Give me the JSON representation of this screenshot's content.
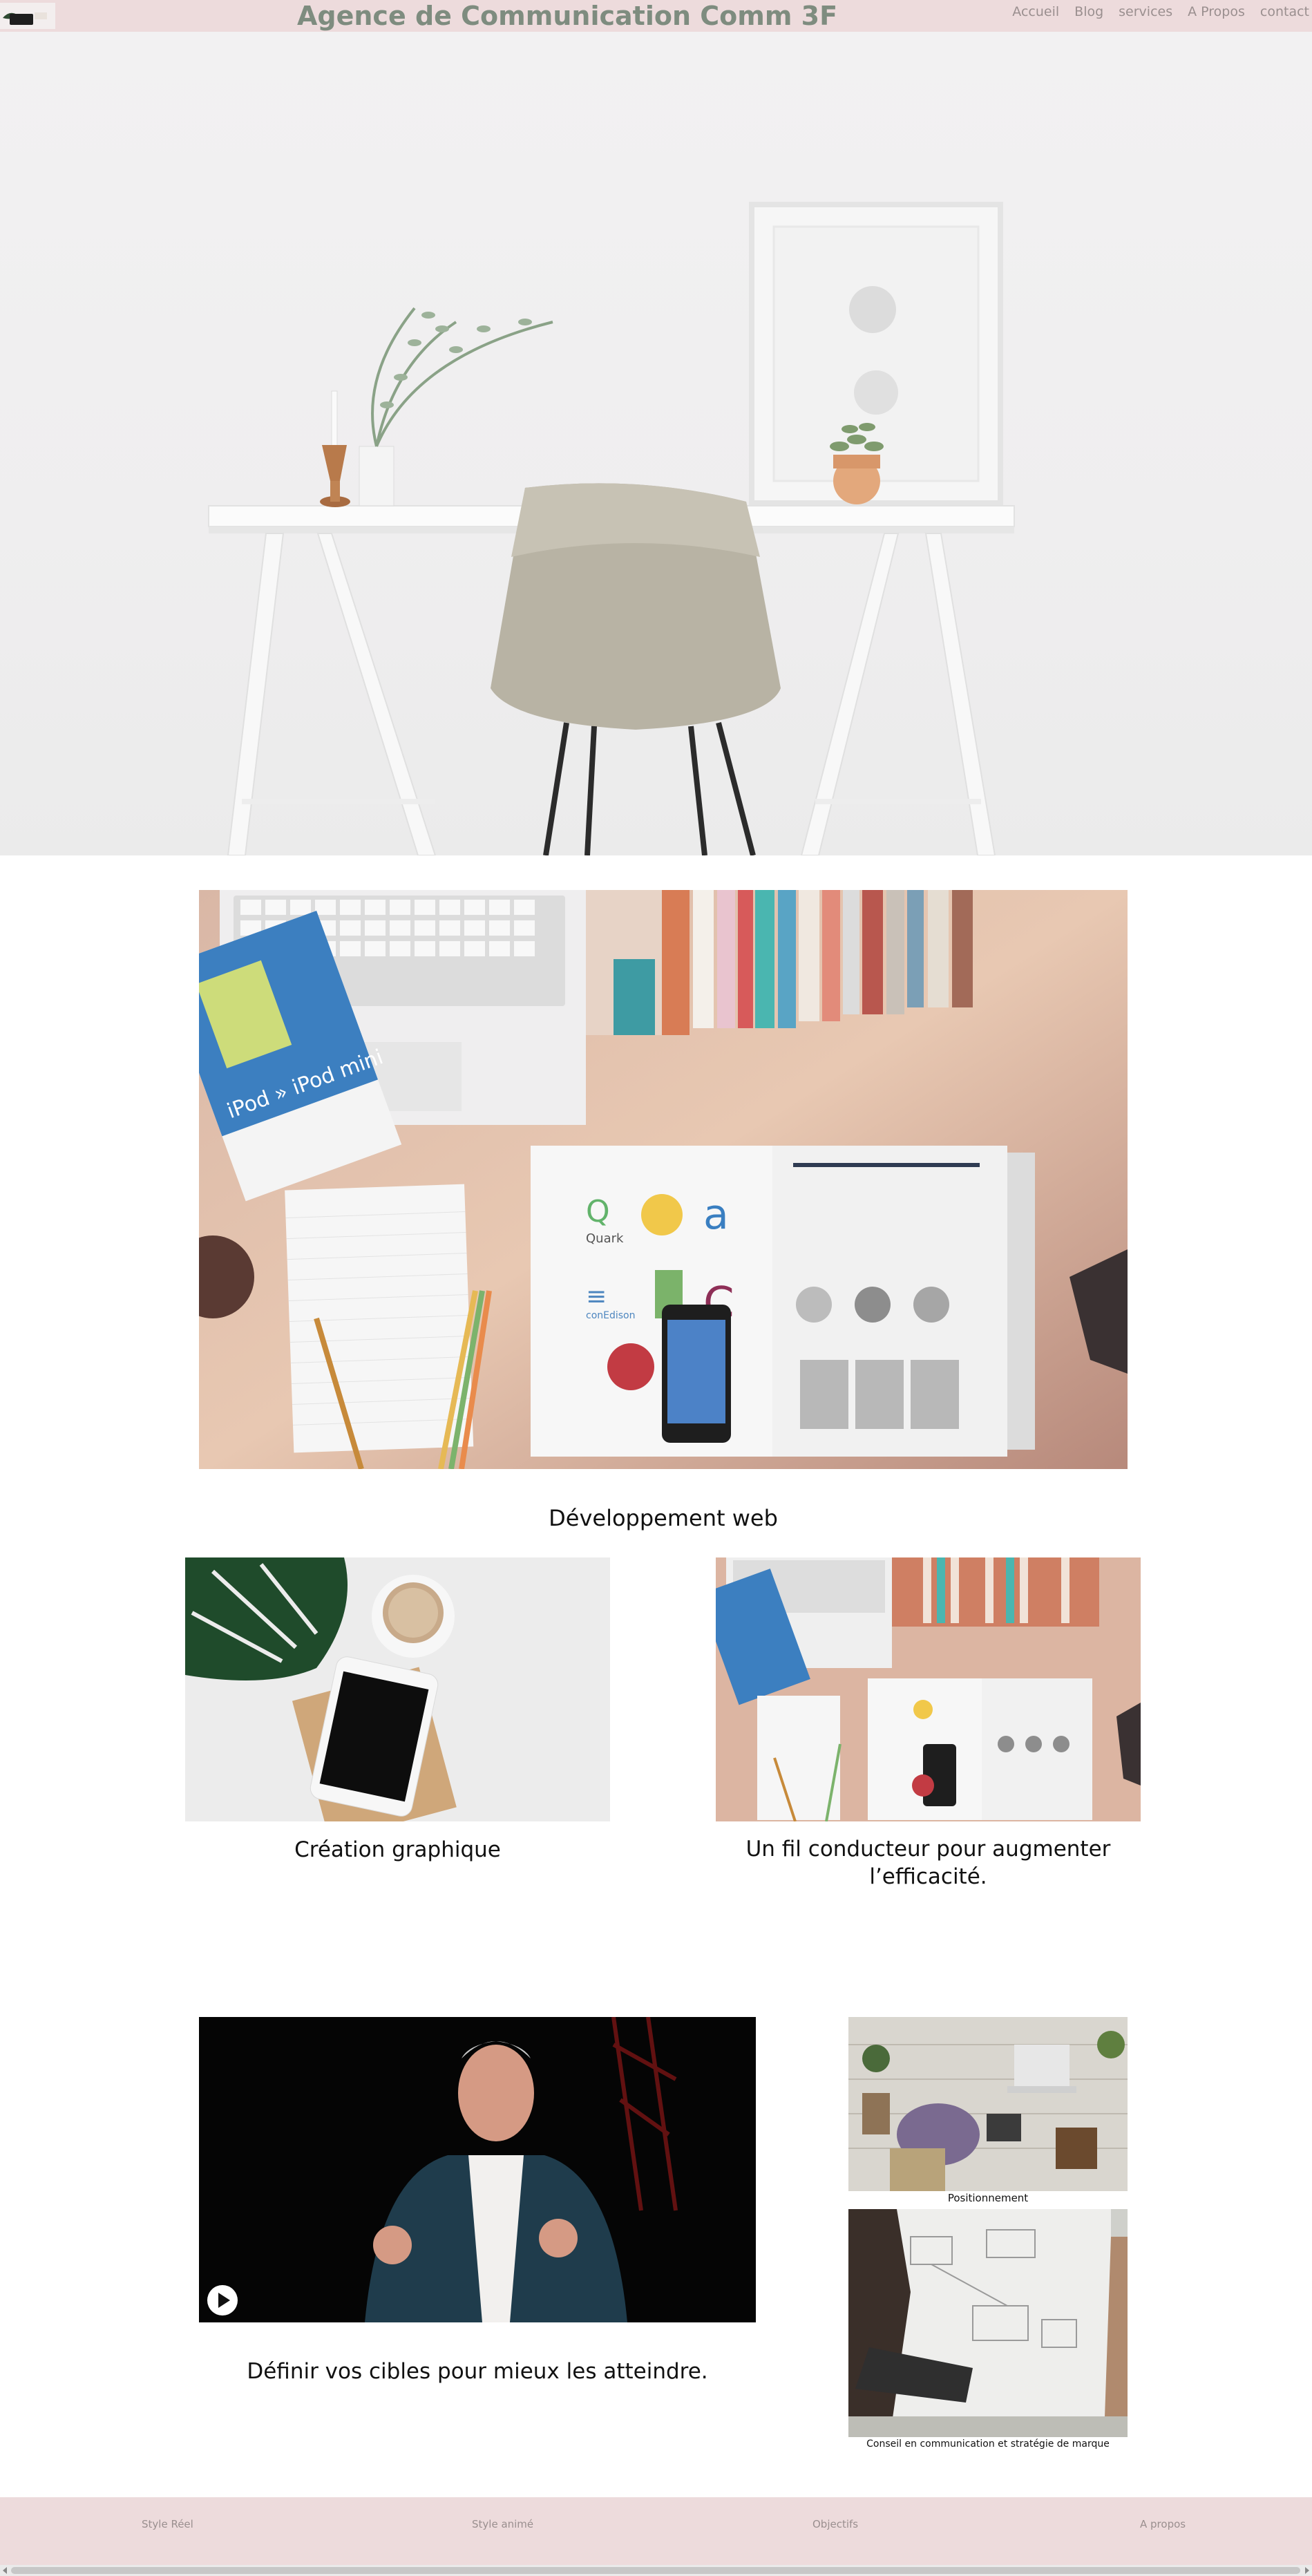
{
  "header": {
    "title": "Agence de Communication Comm 3F",
    "nav": [
      "Accueil",
      "Blog",
      "services",
      "A Propos",
      "contact"
    ]
  },
  "sections": {
    "dev_web": "Développement web",
    "creation": "Création graphique",
    "fil": "Un fil conducteur pour augmenter l’efficacité.",
    "cibles": "Définir vos cibles pour mieux les atteindre.",
    "positionnement": "Positionnement",
    "conseil": "Conseil en communication et stratégie de marque"
  },
  "footer": [
    "Style Réel",
    "Style animé",
    "Objectifs",
    "A propos"
  ],
  "colors": {
    "header_bg": "#eddbdc",
    "title": "#7e8c7f",
    "nav": "#9a8f8f"
  }
}
